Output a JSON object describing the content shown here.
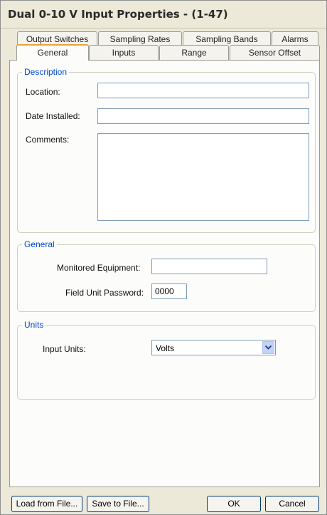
{
  "window": {
    "title": "Dual 0-10 V Input Properties - (1-47)"
  },
  "tabs_row1": [
    {
      "label": "Output Switches"
    },
    {
      "label": "Sampling Rates"
    },
    {
      "label": "Sampling Bands"
    },
    {
      "label": "Alarms"
    }
  ],
  "tabs_row2": [
    {
      "label": "General",
      "active": true
    },
    {
      "label": "Inputs"
    },
    {
      "label": "Range"
    },
    {
      "label": "Sensor Offset"
    }
  ],
  "description": {
    "legend": "Description",
    "location_label": "Location:",
    "location_value": "",
    "date_label": "Date Installed:",
    "date_value": "",
    "comments_label": "Comments:",
    "comments_value": ""
  },
  "general": {
    "legend": "General",
    "monitored_label": "Monitored Equipment:",
    "monitored_value": "",
    "password_label": "Field Unit Password:",
    "password_value": "0000"
  },
  "units": {
    "legend": "Units",
    "input_units_label": "Input Units:",
    "input_units_value": "Volts"
  },
  "buttons": {
    "load": "Load from File...",
    "save": "Save to File...",
    "ok": "OK",
    "cancel": "Cancel"
  }
}
